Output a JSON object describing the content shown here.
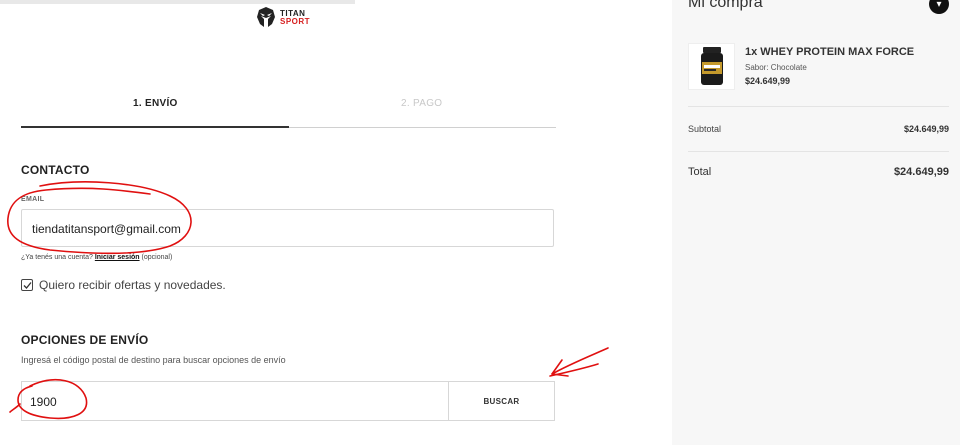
{
  "brand": {
    "line1": "TITAN",
    "line2": "SPORT",
    "accent_color": "#d61f1f"
  },
  "steps": [
    {
      "label": "1. ENVÍO",
      "active": true
    },
    {
      "label": "2. PAGO",
      "active": false
    }
  ],
  "contact": {
    "title": "CONTACTO",
    "email_label": "EMAIL",
    "email_value": "tiendatitansport@gmail.com",
    "account_prefix": "¿Ya tenés una cuenta?",
    "login_link": "Iniciar sesión",
    "account_suffix": "(opcional)",
    "newsletter_label": "Quiero recibir ofertas y novedades.",
    "newsletter_checked": true
  },
  "shipping": {
    "title": "OPCIONES DE ENVÍO",
    "description": "Ingresá el código postal de destino para buscar opciones de envío",
    "zip_value": "1900",
    "search_label": "BUSCAR"
  },
  "summary": {
    "title": "Mi compra",
    "toggle_icon": "chevron-down-icon",
    "product": {
      "name": "1x WHEY PROTEIN MAX FORCE",
      "variant": "Sabor: Chocolate",
      "price": "$24.649,99"
    },
    "subtotal_label": "Subtotal",
    "subtotal_value": "$24.649,99",
    "total_label": "Total",
    "total_value": "$24.649,99"
  },
  "annotation_color": "#e01010"
}
